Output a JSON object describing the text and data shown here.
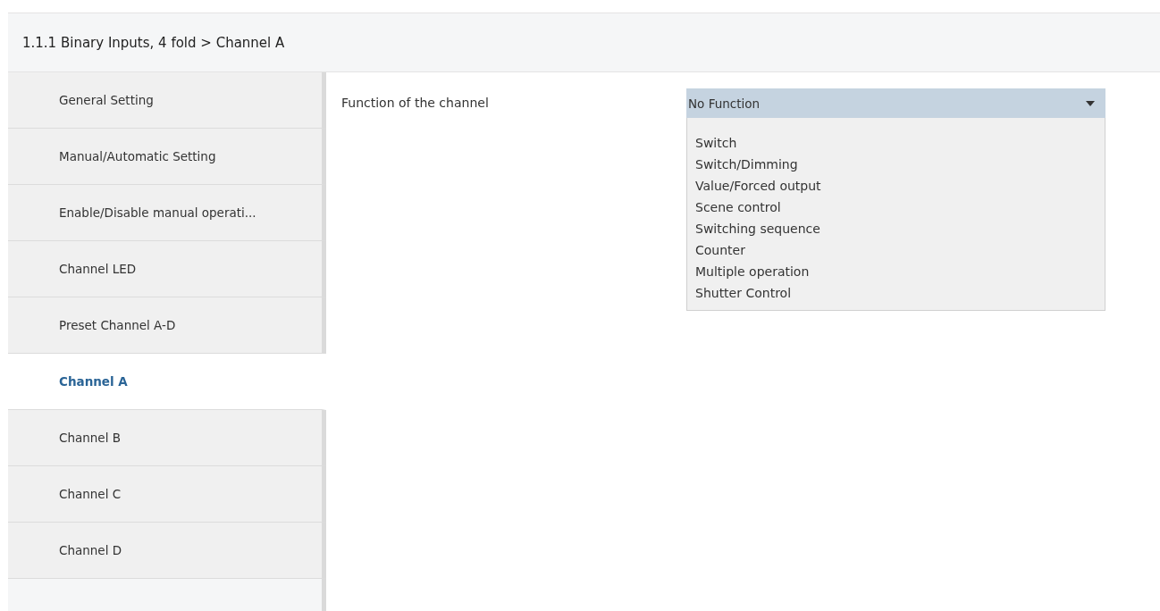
{
  "header": {
    "title": "1.1.1 Binary Inputs, 4 fold > Channel A"
  },
  "sidebar": {
    "items": [
      {
        "label": "General Setting",
        "selected": false
      },
      {
        "label": "Manual/Automatic Setting",
        "selected": false
      },
      {
        "label": "Enable/Disable manual operati...",
        "selected": false
      },
      {
        "label": "Channel LED",
        "selected": false
      },
      {
        "label": "Preset Channel A-D",
        "selected": false
      },
      {
        "label": "Channel A",
        "selected": true
      },
      {
        "label": "Channel B",
        "selected": false
      },
      {
        "label": "Channel C",
        "selected": false
      },
      {
        "label": "Channel D",
        "selected": false
      }
    ]
  },
  "parameter": {
    "label": "Function of the channel",
    "value": "No Function",
    "expanded": true,
    "options": [
      "Switch",
      "Switch/Dimming",
      "Value/Forced output",
      "Scene control",
      "Switching sequence",
      "Counter",
      "Multiple operation",
      "Shutter Control"
    ]
  }
}
